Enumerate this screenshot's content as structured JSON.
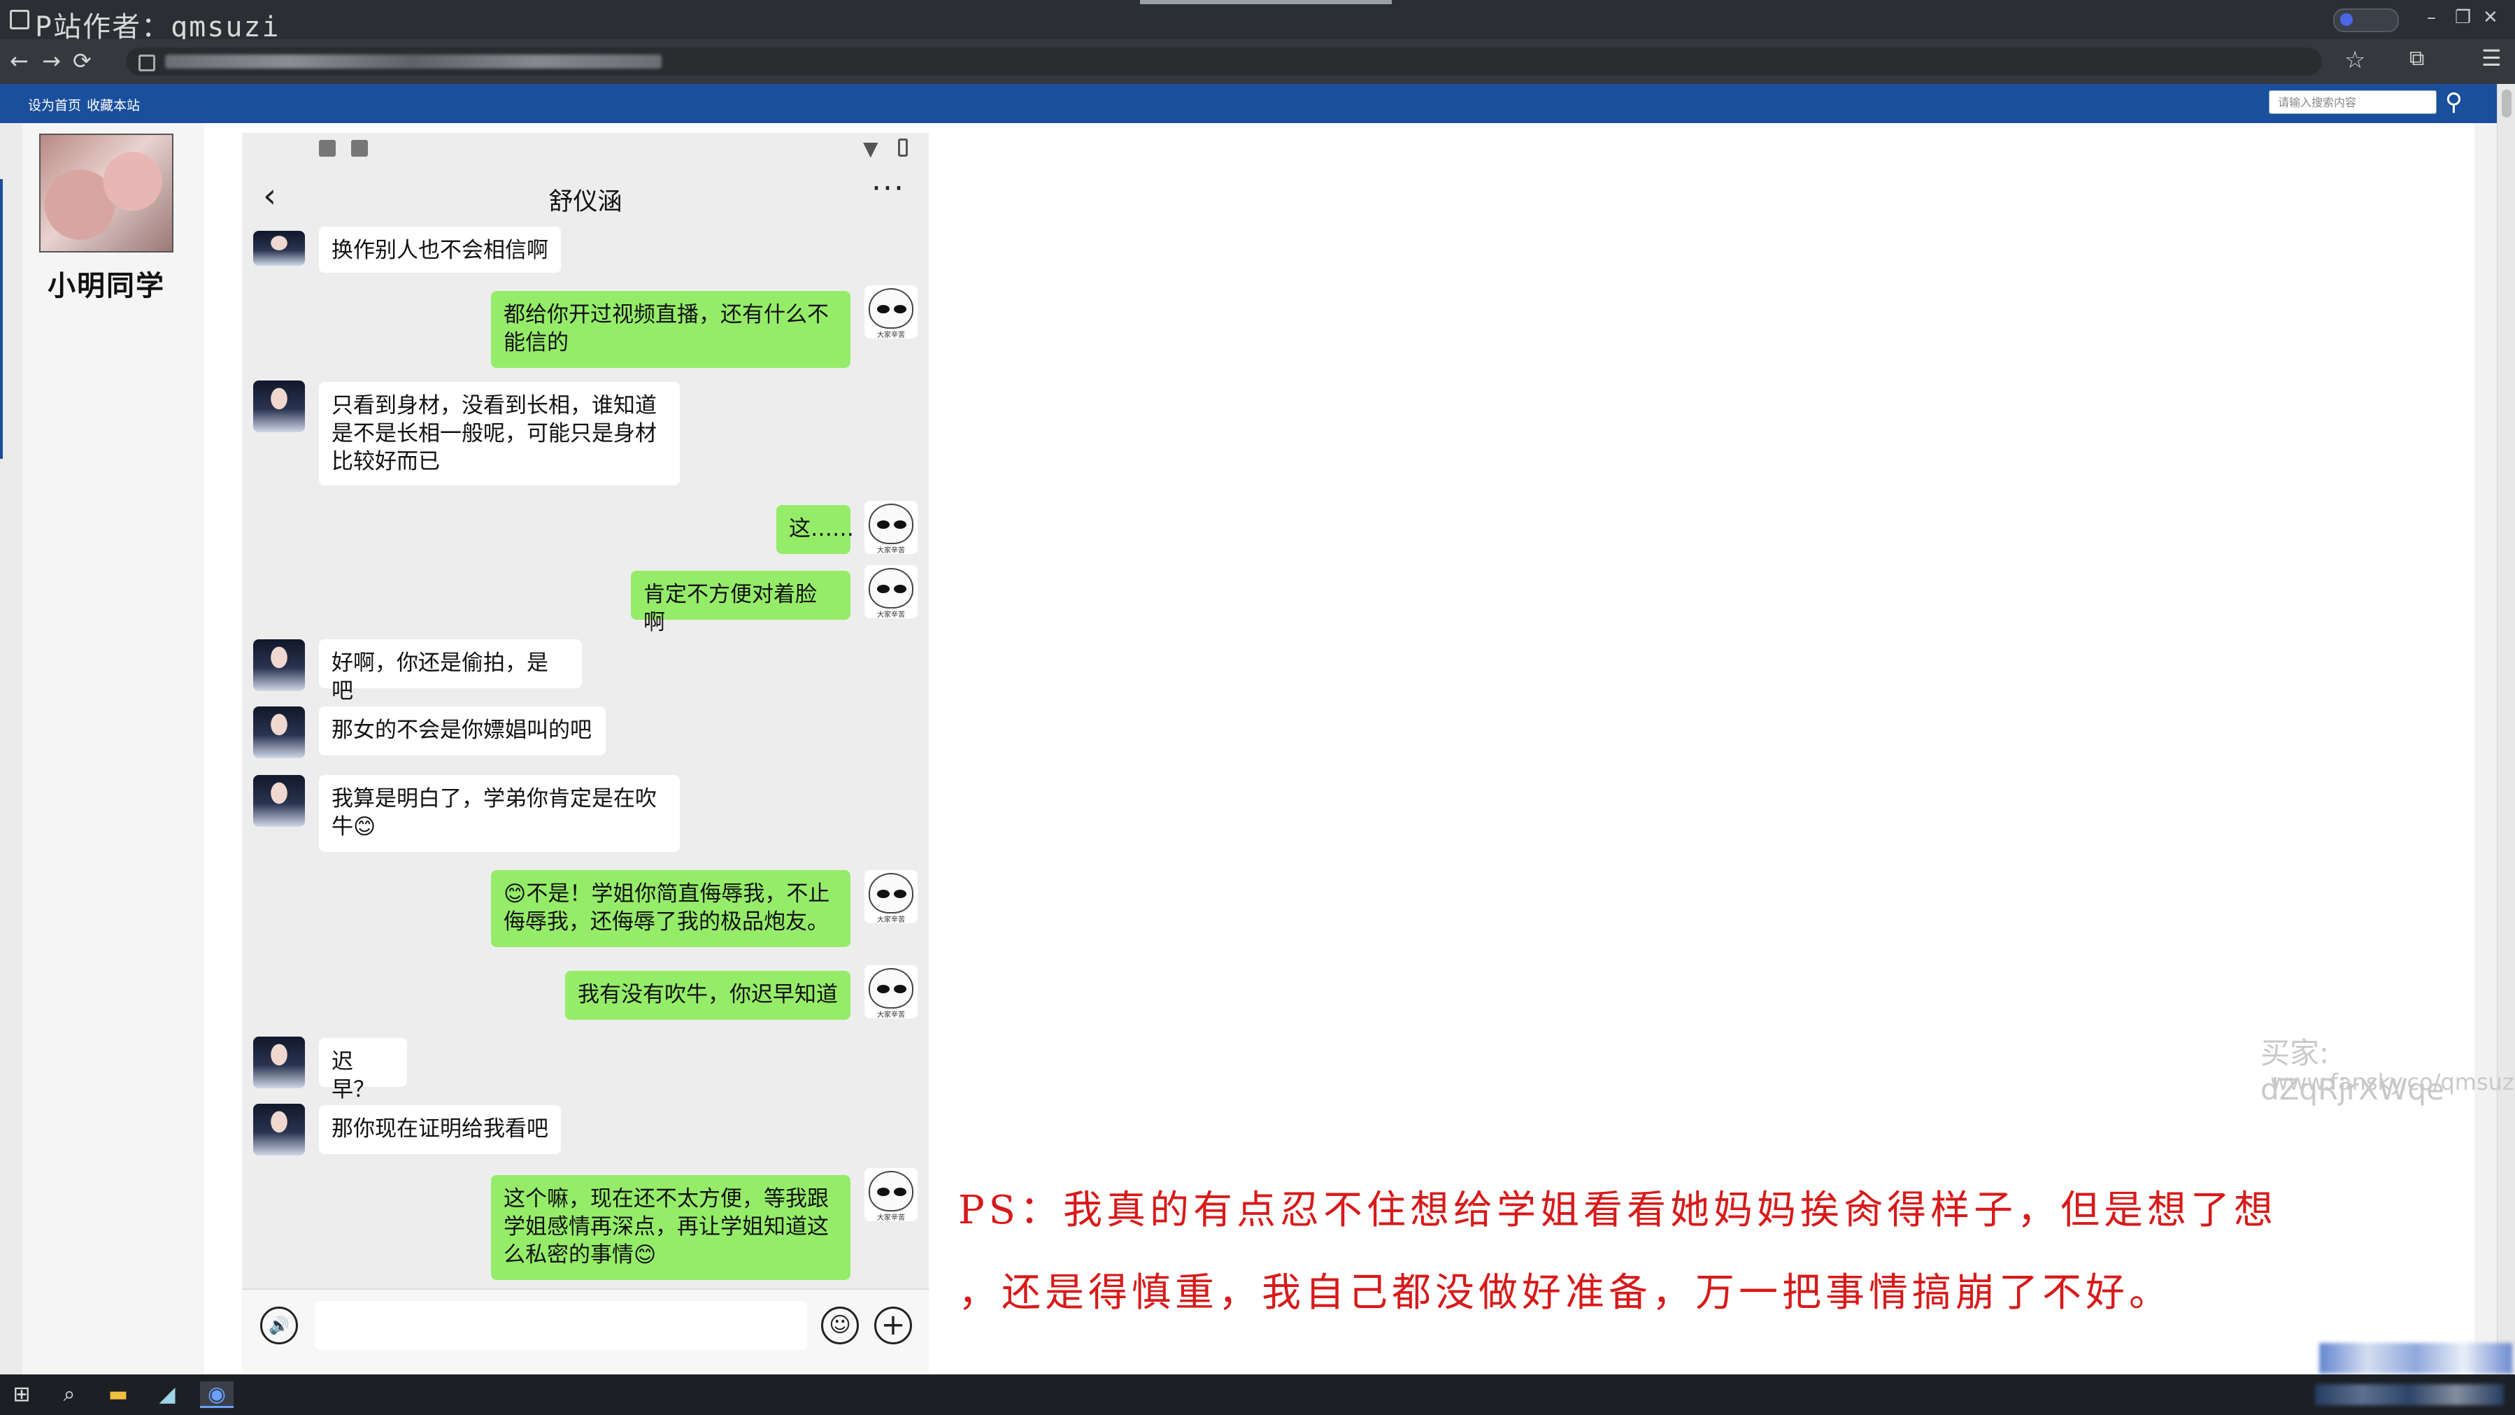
{
  "window": {
    "watermark": "P站作者：qmsuzi",
    "controls": [
      "–",
      "❐",
      "✕"
    ]
  },
  "browser": {
    "back": "←",
    "forward": "→",
    "reload": "⟳",
    "star": "☆",
    "extensions": "⧉",
    "menu": "☰"
  },
  "site": {
    "links": [
      "设为首页",
      "收藏本站"
    ],
    "search_placeholder": "请输入搜索内容",
    "search_icon": "⚲"
  },
  "profile": {
    "name": "小明同学"
  },
  "chat": {
    "title": "舒仪涵",
    "back": "‹",
    "more": "···",
    "me_avatar_caption": "大家辛苦",
    "messages": [
      {
        "from": "her",
        "text": "换作别人也不会相信啊"
      },
      {
        "from": "me",
        "text": "都给你开过视频直播，还有什么不\n能信的"
      },
      {
        "from": "her",
        "text": "只看到身材，没看到长相，谁知道\n是不是长相一般呢，可能只是身材\n比较好而已"
      },
      {
        "from": "me",
        "text": "这……"
      },
      {
        "from": "me",
        "text": "肯定不方便对着脸啊"
      },
      {
        "from": "her",
        "text": "好啊，你还是偷拍，是吧"
      },
      {
        "from": "her",
        "text": "那女的不会是你嫖娼叫的吧"
      },
      {
        "from": "her",
        "text": "我算是明白了，学弟你肯定是在吹\n牛😊"
      },
      {
        "from": "me",
        "text": "😊不是！学姐你简直侮辱我，不止\n侮辱我，还侮辱了我的极品炮友。"
      },
      {
        "from": "me",
        "text": "我有没有吹牛，你迟早知道"
      },
      {
        "from": "her",
        "text": "迟早？"
      },
      {
        "from": "her",
        "text": "那你现在证明给我看吧"
      },
      {
        "from": "me",
        "text": "这个嘛，现在还不太方便，等我跟\n学姐感情再深点，再让学姐知道这\n么私密的事情😊"
      }
    ],
    "input": {
      "voice_icon": "🔊",
      "emoji_icon": "☺",
      "plus_icon": "+"
    }
  },
  "overlay": {
    "buyer": "买家: dZqRjrXWqe",
    "buyer_url": "www.fansky.co/qmsuzi",
    "ps_line1": "PS：我真的有点忍不住想给学姐看看她妈妈挨肏得样子，但是想了想",
    "ps_line2": "，还是得慎重，我自己都没做好准备，万一把事情搞崩了不好。"
  },
  "taskbar": {
    "start": "⊞",
    "search": "⌕",
    "explorer": "▬",
    "app": "◢",
    "browser": "◉"
  }
}
